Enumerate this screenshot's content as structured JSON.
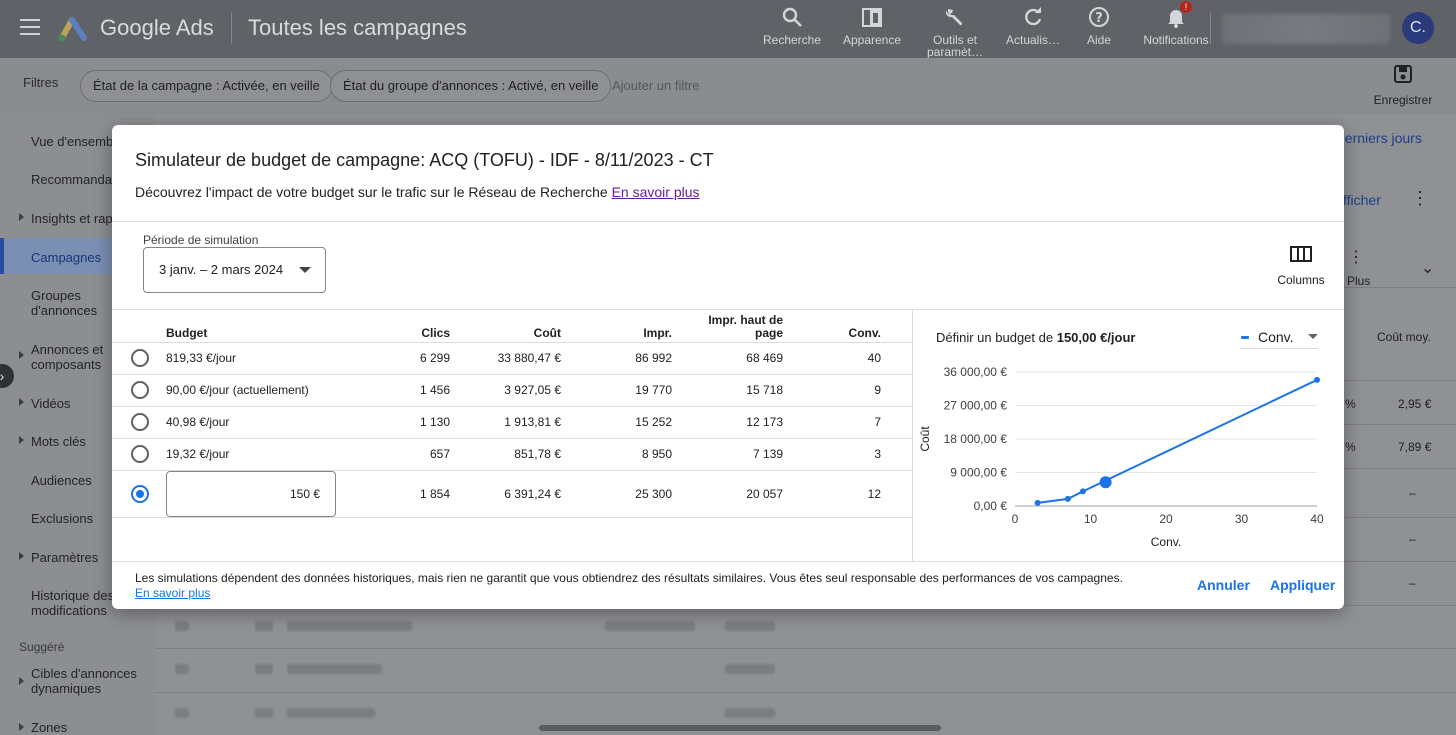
{
  "app": {
    "brand": "Google Ads",
    "page_title": "Toutes les campagnes",
    "tools": [
      {
        "label": "Recherche",
        "icon": "search-icon"
      },
      {
        "label": "Apparence",
        "icon": "appearance-icon"
      },
      {
        "label": "Outils et paramèt…",
        "icon": "wrench-icon"
      },
      {
        "label": "Actualis…",
        "icon": "refresh-icon"
      },
      {
        "label": "Aide",
        "icon": "help-icon"
      },
      {
        "label": "Notifications",
        "icon": "bell-icon",
        "badge": "!"
      }
    ],
    "avatar": "C."
  },
  "filters": {
    "label": "Filtres",
    "chips": [
      "État de la campagne : Activée, en veille",
      "État du groupe d'annonces : Activé, en veille"
    ],
    "add_filter": "Ajouter un filtre",
    "save": "Enregistrer"
  },
  "sidebar": {
    "items": [
      "Vue d'ensemble",
      "Recommandat…",
      "Insights et rapp…",
      "Campagnes",
      "Groupes d'annonces",
      "Annonces et composants",
      "Vidéos",
      "Mots clés",
      "Audiences",
      "Exclusions",
      "Paramètres",
      "Historique des modifications"
    ],
    "suggested_label": "Suggéré",
    "suggested_items": [
      "Cibles d'annonces dynamiques",
      "Zones"
    ]
  },
  "background": {
    "date_range": "derniers jours",
    "afficher": "fficher",
    "plus": "Plus",
    "col_headers": [
      "Coût moy."
    ],
    "cost_avg": [
      "2,95 €",
      "7,89 €",
      "–",
      "–",
      "–"
    ],
    "pct": [
      "%",
      "%"
    ]
  },
  "modal": {
    "title": "Simulateur de budget de campagne: ACQ (TOFU) - IDF - 8/11/2023 - CT",
    "subtitle": "Découvrez l'impact de votre budget sur le trafic sur le Réseau de Recherche",
    "learn_more": "En savoir plus",
    "period_label": "Période de simulation",
    "period_value": "3 janv. – 2 mars 2024",
    "columns_label": "Columns",
    "table": {
      "headers": [
        "Budget",
        "Clics",
        "Coût",
        "Impr.",
        "Impr. haut de page",
        "Conv."
      ],
      "rows": [
        {
          "budget": "819,33 €/jour",
          "clics": "6 299",
          "cout": "33 880,47 €",
          "impr": "86 992",
          "impr_haut": "68 469",
          "conv": "40",
          "selected": false
        },
        {
          "budget": "90,00 €/jour (actuellement)",
          "clics": "1 456",
          "cout": "3 927,05 €",
          "impr": "19 770",
          "impr_haut": "15 718",
          "conv": "9",
          "selected": false
        },
        {
          "budget": "40,98 €/jour",
          "clics": "1 130",
          "cout": "1 913,81 €",
          "impr": "15 252",
          "impr_haut": "12 173",
          "conv": "7",
          "selected": false
        },
        {
          "budget": "19,32 €/jour",
          "clics": "657",
          "cout": "851,78 €",
          "impr": "8 950",
          "impr_haut": "7 139",
          "conv": "3",
          "selected": false
        }
      ],
      "custom": {
        "budget_value": "150 €",
        "clics": "1 854",
        "cout": "6 391,24 €",
        "impr": "25 300",
        "impr_haut": "20 057",
        "conv": "12",
        "selected": true
      }
    },
    "chart_header_prefix": "Définir un budget de",
    "chart_header_value": "150,00 €/jour",
    "metric_select": "Conv.",
    "footer_note": "Les simulations dépendent des données historiques, mais rien ne garantit que vous obtiendrez des résultats similaires. Vous êtes seul responsable des performances de vos campagnes.",
    "footer_link": "En savoir plus",
    "cancel": "Annuler",
    "apply": "Appliquer"
  },
  "colors": {
    "accent": "#1a73e8",
    "link_visited": "#6a1b9a",
    "topbar": "#5f6368"
  },
  "chart_data": {
    "type": "line",
    "xlabel": "Conv.",
    "ylabel": "Coût",
    "xlim": [
      0,
      40
    ],
    "ylim": [
      0,
      36000
    ],
    "xticks": [
      0,
      10,
      20,
      30,
      40
    ],
    "yticks": [
      0,
      9000,
      18000,
      27000,
      36000
    ],
    "ytick_labels": [
      "0,00 €",
      "9 000,00 €",
      "18 000,00 €",
      "27 000,00 €",
      "36 000,00 €"
    ],
    "series": [
      {
        "x": [
          3,
          7,
          9,
          40
        ],
        "y": [
          851.78,
          1913.81,
          3927.05,
          33880.47
        ]
      }
    ],
    "highlight": {
      "x": 12,
      "y": 6391.24
    },
    "grid": true
  }
}
